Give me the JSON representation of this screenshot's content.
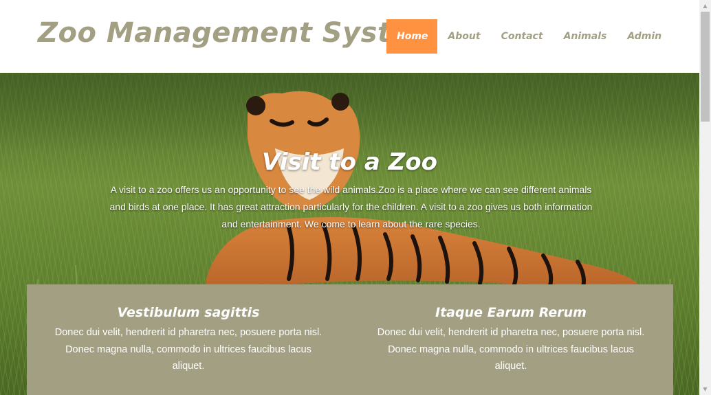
{
  "header": {
    "logo_text": "Zoo Management System"
  },
  "nav": {
    "items": [
      {
        "label": "Home",
        "active": true
      },
      {
        "label": "About",
        "active": false
      },
      {
        "label": "Contact",
        "active": false
      },
      {
        "label": "Animals",
        "active": false
      },
      {
        "label": "Admin",
        "active": false
      }
    ]
  },
  "hero": {
    "title": "Visit to a Zoo",
    "text": "A visit to a zoo offers us an opportunity to see the wild animals.Zoo is a place where we can see different animals and birds at one place. It has great attraction particularly for the children. A visit to a zoo gives us both information and entertainment. We come to learn about the rare species.",
    "image": "tiger-in-grass"
  },
  "features": [
    {
      "title": "Vestibulum sagittis",
      "text": "Donec dui velit, hendrerit id pharetra nec, posuere porta nisl. Donec magna nulla, commodo in ultrices faucibus lacus aliquet."
    },
    {
      "title": "Itaque Earum Rerum",
      "text": "Donec dui velit, hendrerit id pharetra nec, posuere porta nisl. Donec magna nulla, commodo in ultrices faucibus lacus aliquet."
    }
  ],
  "colors": {
    "accent": "#ff9240",
    "brand": "#a39f83",
    "panel": "#a39f83"
  },
  "scrollbar": {
    "up_icon": "chevron-up-icon",
    "down_icon": "chevron-down-icon"
  }
}
